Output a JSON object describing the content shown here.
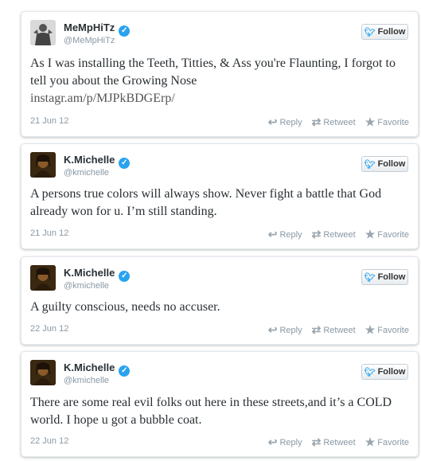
{
  "colors": {
    "verified": "#2aa3ef",
    "bird": "#2aa3ef",
    "meta": "#8899a6"
  },
  "follow_label": "Follow",
  "actions": {
    "reply": "Reply",
    "retweet": "Retweet",
    "favorite": "Favorite"
  },
  "tweets": [
    {
      "name": "MeMpHiTz",
      "handle": "@MeMpHiTz",
      "text": "As I was installing the Teeth, Titties, & Ass you're Flaunting, I forgot to tell you about the Growing Nose",
      "link": "instagr.am/p/MJPkBDGErp/",
      "date": "21 Jun 12"
    },
    {
      "name": "K.Michelle",
      "handle": "@kmichelle",
      "text": "A persons true colors will always show. Never fight a battle that God already won for u. I’m still standing.",
      "date": "21 Jun 12"
    },
    {
      "name": "K.Michelle",
      "handle": "@kmichelle",
      "text": "A guilty conscious, needs no accuser.",
      "date": "22 Jun 12"
    },
    {
      "name": "K.Michelle",
      "handle": "@kmichelle",
      "text": "There are some real evil folks out here in these streets,and it’s a COLD world. I hope u got a bubble coat.",
      "date": "22 Jun 12"
    }
  ]
}
